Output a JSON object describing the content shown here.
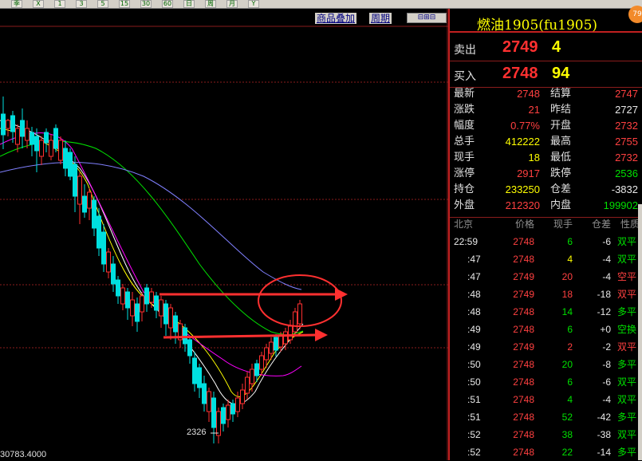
{
  "toolbar": {
    "buttons": [
      "季",
      "X",
      "1",
      "3",
      "5",
      "15",
      "30",
      "60",
      "日",
      "周",
      "月",
      "Y"
    ]
  },
  "chart_links": {
    "overlay": "商品叠加",
    "period": "周期"
  },
  "chart_annot": {
    "low_label": "2326",
    "bottom_value": "30783.4000"
  },
  "header": {
    "title": "燃油1905(fu1905)",
    "badge": "79"
  },
  "quote": {
    "sell_label": "卖出",
    "sell_price": "2749",
    "sell_vol": "4",
    "buy_label": "买入",
    "buy_price": "2748",
    "buy_vol": "94"
  },
  "stats": [
    {
      "l1": "最新",
      "v1": "2748",
      "c1": "red",
      "l2": "结算",
      "v2": "2747",
      "c2": "red"
    },
    {
      "l1": "涨跌",
      "v1": "21",
      "c1": "red",
      "l2": "昨结",
      "v2": "2727",
      "c2": "white"
    },
    {
      "l1": "幅度",
      "v1": "0.77%",
      "c1": "red",
      "l2": "开盘",
      "v2": "2732",
      "c2": "red"
    },
    {
      "l1": "总手",
      "v1": "412222",
      "c1": "yellow",
      "l2": "最高",
      "v2": "2755",
      "c2": "red"
    },
    {
      "l1": "现手",
      "v1": "18",
      "c1": "yellow",
      "l2": "最低",
      "v2": "2732",
      "c2": "red"
    },
    {
      "l1": "涨停",
      "v1": "2917",
      "c1": "red",
      "l2": "跌停",
      "v2": "2536",
      "c2": "green"
    },
    {
      "l1": "持仓",
      "v1": "233250",
      "c1": "yellow",
      "l2": "仓差",
      "v2": "-3832",
      "c2": "white"
    },
    {
      "l1": "外盘",
      "v1": "212320",
      "c1": "red",
      "l2": "内盘",
      "v2": "199902",
      "c2": "green"
    }
  ],
  "trades_header": {
    "time": "北京",
    "price": "价格",
    "vol": "现手",
    "oi": "仓差",
    "type": "性质"
  },
  "trades": [
    {
      "time": "22:59",
      "price": "2748",
      "vol": "6",
      "oi": "-6",
      "type": "双平",
      "pc": "red",
      "vc": "green",
      "tc": "green"
    },
    {
      "time": ":47",
      "price": "2748",
      "vol": "4",
      "oi": "-4",
      "type": "双平",
      "pc": "red",
      "vc": "yellow",
      "tc": "green"
    },
    {
      "time": ":47",
      "price": "2749",
      "vol": "20",
      "oi": "-4",
      "type": "空平",
      "pc": "red",
      "vc": "red",
      "tc": "red"
    },
    {
      "time": ":48",
      "price": "2749",
      "vol": "18",
      "oi": "-18",
      "type": "双平",
      "pc": "red",
      "vc": "red",
      "tc": "red"
    },
    {
      "time": ":48",
      "price": "2748",
      "vol": "14",
      "oi": "-12",
      "type": "多平",
      "pc": "red",
      "vc": "green",
      "tc": "green"
    },
    {
      "time": ":49",
      "price": "2748",
      "vol": "6",
      "oi": "+0",
      "type": "空换",
      "pc": "red",
      "vc": "green",
      "tc": "green"
    },
    {
      "time": ":49",
      "price": "2749",
      "vol": "2",
      "oi": "-2",
      "type": "双平",
      "pc": "red",
      "vc": "red",
      "tc": "red"
    },
    {
      "time": ":50",
      "price": "2748",
      "vol": "20",
      "oi": "-8",
      "type": "多平",
      "pc": "red",
      "vc": "green",
      "tc": "green"
    },
    {
      "time": ":50",
      "price": "2748",
      "vol": "6",
      "oi": "-6",
      "type": "双平",
      "pc": "red",
      "vc": "green",
      "tc": "green"
    },
    {
      "time": ":51",
      "price": "2748",
      "vol": "4",
      "oi": "-4",
      "type": "双平",
      "pc": "red",
      "vc": "green",
      "tc": "green"
    },
    {
      "time": ":51",
      "price": "2748",
      "vol": "52",
      "oi": "-42",
      "type": "多平",
      "pc": "red",
      "vc": "green",
      "tc": "green"
    },
    {
      "time": ":52",
      "price": "2748",
      "vol": "38",
      "oi": "-38",
      "type": "双平",
      "pc": "red",
      "vc": "green",
      "tc": "green"
    },
    {
      "time": ":52",
      "price": "2748",
      "vol": "22",
      "oi": "-14",
      "type": "多平",
      "pc": "red",
      "vc": "green",
      "tc": "green"
    }
  ],
  "colors": {
    "up": "#ff3030",
    "down": "#00e0e0",
    "accent": "#ffff00",
    "border": "#c02020"
  }
}
